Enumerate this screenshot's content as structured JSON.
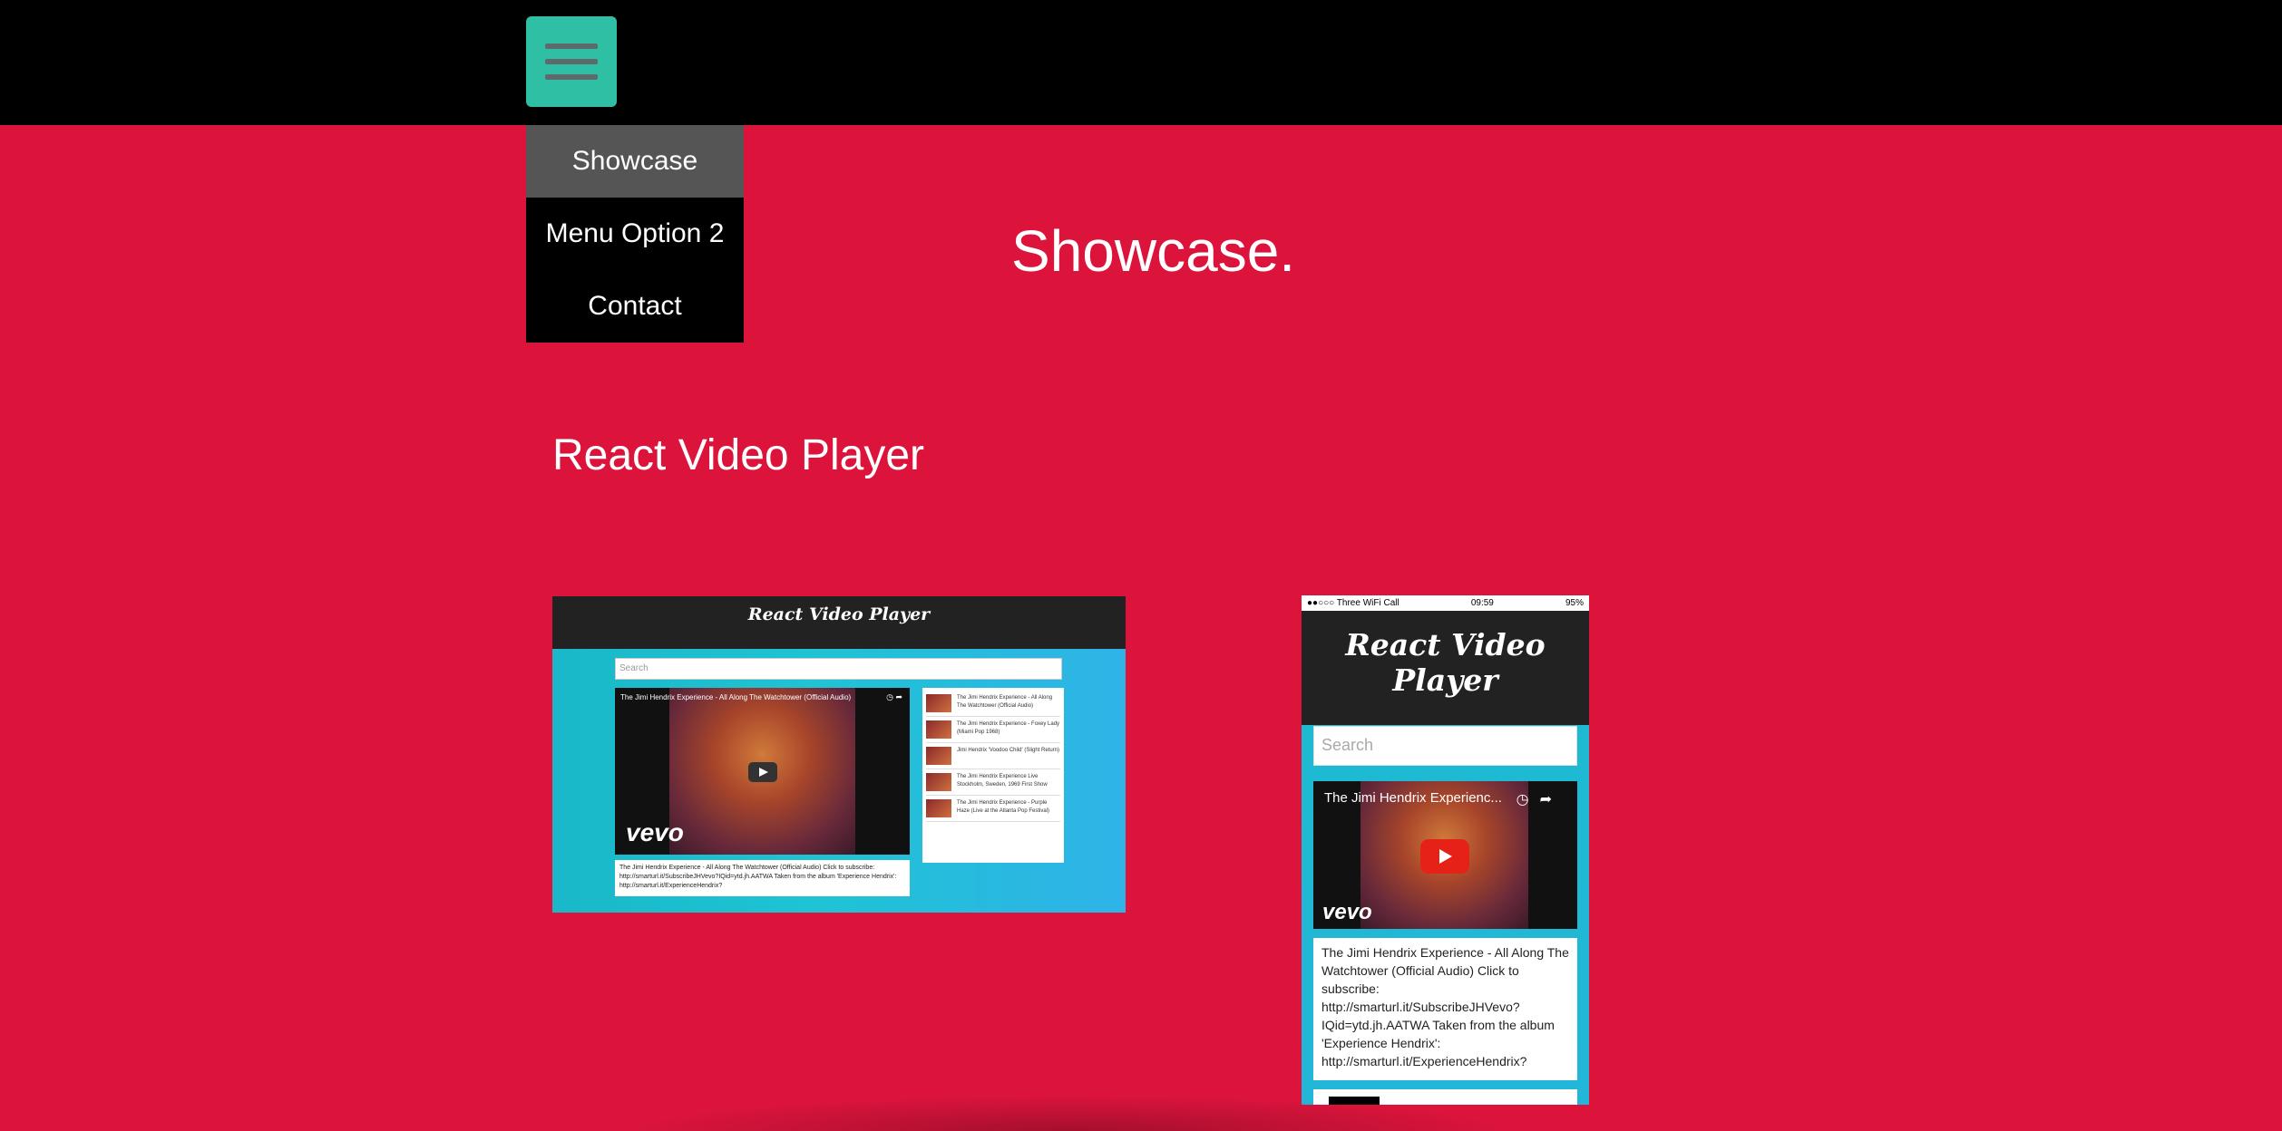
{
  "nav": {
    "menu_icon": "hamburger-menu-icon",
    "items": [
      {
        "label": "Showcase",
        "active": true
      },
      {
        "label": "Menu Option 2",
        "active": false
      },
      {
        "label": "Contact",
        "active": false
      }
    ]
  },
  "hero": {
    "title": "Showcase."
  },
  "project": {
    "title": "React Video Player",
    "desktop_shot": {
      "app_title": "React Video Player",
      "search_placeholder": "Search",
      "video_title": "The Jimi Hendrix Experience - All Along The Watchtower (Official Audio)",
      "video_brand": "vevo",
      "description": "The Jimi Hendrix Experience - All Along The Watchtower (Official Audio) Click to subscribe: http://smarturl.it/SubscribeJHVevo?IQid=ytd.jh.AATWA Taken from the album 'Experience Hendrix': http://smarturl.it/ExperienceHendrix?",
      "list": [
        "The Jimi Hendrix Experience - All Along The Watchtower (Official Audio)",
        "The Jimi Hendrix Experience - Foxey Lady (Miami Pop 1968)",
        "Jimi Hendrix 'Voodoo Child' (Slight Return)",
        "The Jimi Hendrix Experience Live Stockholm, Sweden, 1969 First Show",
        "The Jimi Hendrix Experience - Purple Haze (Live at the Atlanta Pop Festival)"
      ]
    },
    "mobile_shot": {
      "status_left": "●●○○○ Three WiFi Call",
      "status_time": "09:59",
      "status_right": "95%",
      "app_title": "React Video Player",
      "search_placeholder": "Search",
      "video_title": "The Jimi Hendrix Experienc...",
      "video_brand": "vevo",
      "description": "The Jimi Hendrix Experience - All Along The Watchtower (Official Audio) Click to subscribe: http://smarturl.it/SubscribeJHVevo?IQid=ytd.jh.AATWA Taken from the album 'Experience Hendrix': http://smarturl.it/ExperienceHendrix?"
    }
  }
}
